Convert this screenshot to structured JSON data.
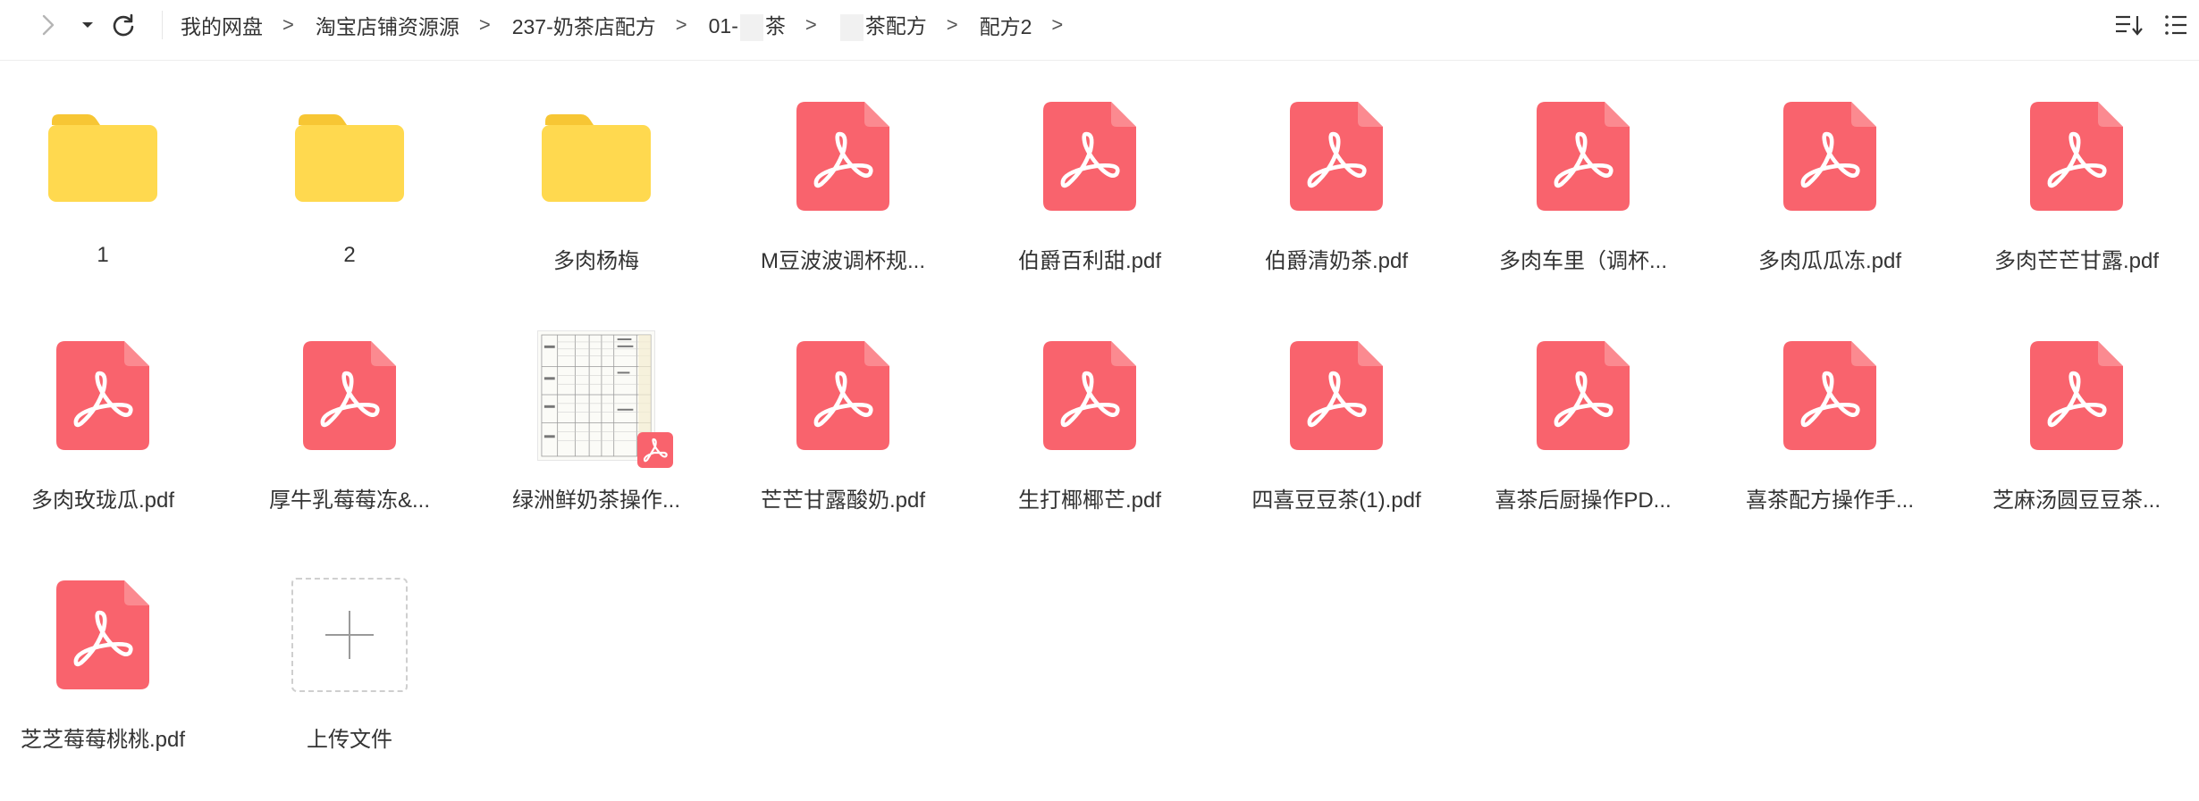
{
  "breadcrumb": [
    {
      "label": "我的网盘"
    },
    {
      "label": "淘宝店铺资源源"
    },
    {
      "label": "237-奶茶店配方"
    },
    {
      "label_a": "01-",
      "label_b": "茶"
    },
    {
      "label_a": "",
      "label_b": "茶配方"
    },
    {
      "label": "配方2"
    }
  ],
  "items": [
    {
      "type": "folder",
      "name": "1"
    },
    {
      "type": "folder",
      "name": "2"
    },
    {
      "type": "folder",
      "name": "多肉杨梅"
    },
    {
      "type": "pdf",
      "name": "M豆波波调杯规..."
    },
    {
      "type": "pdf",
      "name": "伯爵百利甜.pdf"
    },
    {
      "type": "pdf",
      "name": "伯爵清奶茶.pdf"
    },
    {
      "type": "pdf",
      "name": "多肉车里（调杯..."
    },
    {
      "type": "pdf",
      "name": "多肉瓜瓜冻.pdf"
    },
    {
      "type": "pdf",
      "name": "多肉芒芒甘露.pdf"
    },
    {
      "type": "pdf",
      "name": "多肉玫珑瓜.pdf"
    },
    {
      "type": "pdf",
      "name": "厚牛乳莓莓冻&..."
    },
    {
      "type": "pdf-thumb",
      "name": "绿洲鲜奶茶操作..."
    },
    {
      "type": "pdf",
      "name": "芒芒甘露酸奶.pdf"
    },
    {
      "type": "pdf",
      "name": "生打椰椰芒.pdf"
    },
    {
      "type": "pdf",
      "name": "四喜豆豆茶(1).pdf"
    },
    {
      "type": "pdf",
      "name": "喜茶后厨操作PD..."
    },
    {
      "type": "pdf",
      "name": "喜茶配方操作手..."
    },
    {
      "type": "pdf",
      "name": "芝麻汤圆豆豆茶..."
    },
    {
      "type": "pdf",
      "name": "芝芝莓莓桃桃.pdf"
    },
    {
      "type": "upload",
      "name": "上传文件"
    }
  ],
  "colors": {
    "pdf_red": "#f9636d",
    "folder_yellow": "#ffd94f",
    "folder_tab": "#f7c634"
  },
  "icons": [
    "forward-arrow-icon",
    "dropdown-icon",
    "refresh-icon",
    "sort-icon",
    "list-view-icon",
    "pdf-icon",
    "folder-icon",
    "plus-icon"
  ]
}
